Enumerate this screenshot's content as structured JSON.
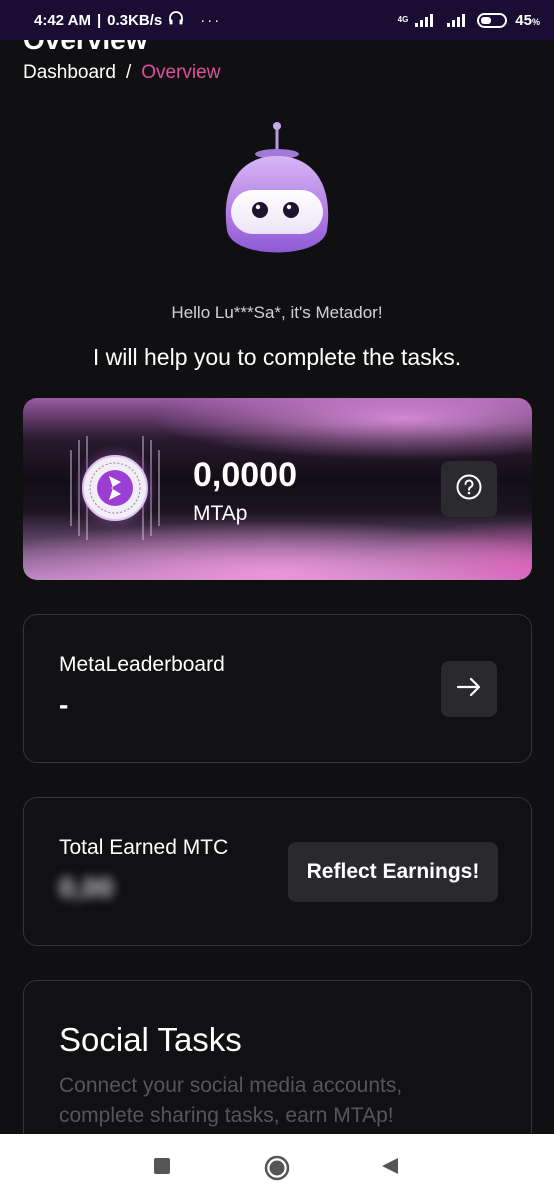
{
  "status_bar": {
    "time": "4:42 AM",
    "speed": "0.3KB/s",
    "dots": "···",
    "network": "4G",
    "battery": "45",
    "battery_unit": "%",
    "battery_level": 0.45
  },
  "header": {
    "title": "Overview",
    "breadcrumb": {
      "home": "Dashboard",
      "separator": "/",
      "current": "Overview"
    }
  },
  "greeting": "Hello Lu***Sa*, it's Metador!",
  "headline": "I will help you to complete the tasks.",
  "balance": {
    "value": "0,0000",
    "unit": "MTAp"
  },
  "leaderboard": {
    "title": "MetaLeaderboard",
    "rank": "-"
  },
  "earned": {
    "title": "Total Earned MTC",
    "value": "0,00",
    "button_label": "Reflect Earnings!"
  },
  "social_tasks": {
    "title": "Social Tasks",
    "description": "Connect your social media accounts, complete sharing tasks, earn MTAp!"
  },
  "colors": {
    "accent": "#e0509a",
    "background": "#101012",
    "card_border": "#34343a"
  },
  "icons": [
    "headphones-icon",
    "signal-icon",
    "battery-icon",
    "robot-mascot",
    "coin-logo",
    "help-icon",
    "arrow-right-icon",
    "recent-apps-icon",
    "home-icon",
    "back-icon"
  ]
}
